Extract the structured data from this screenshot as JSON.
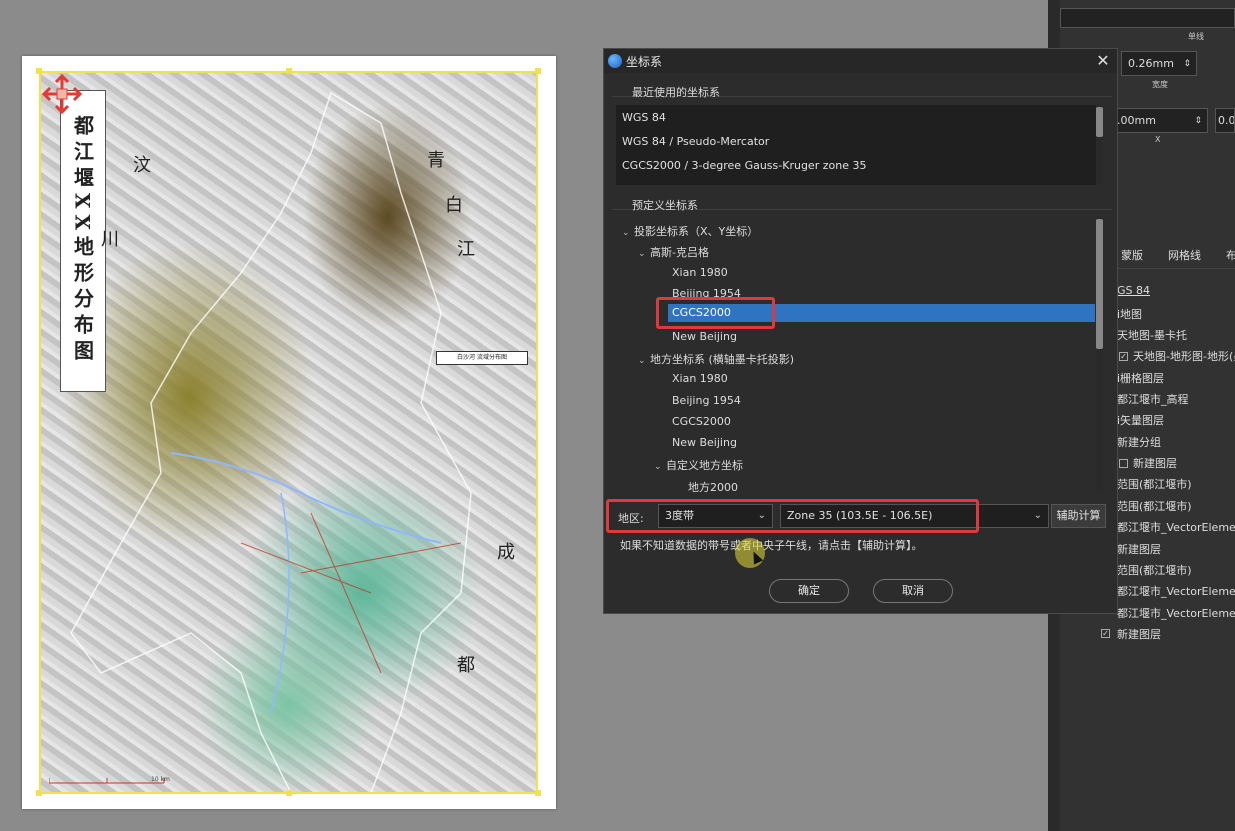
{
  "map": {
    "title": "都江堰XX地形分布图",
    "callout": "白沙河 流域分布图",
    "places": [
      "汶",
      "川",
      "青",
      "白",
      "江",
      "成",
      "都"
    ],
    "scale_text": "10 km"
  },
  "right_panel": {
    "line_label": "单线",
    "width_value": "0.26mm",
    "width_label": "宽度",
    "x_value": ".00mm",
    "x_label": "X",
    "y_value": "0.0",
    "tabs": [
      "蒙版",
      "网格线",
      "布"
    ],
    "layers": [
      "GS 84",
      "i地图",
      "天地图-墨卡托",
      "天地图-地形图-地形(墨",
      "i栅格图层",
      "都江堰市_高程",
      "i矢量图层",
      "新建分组",
      "新建图层",
      "范围(都江堰市)",
      "范围(都江堰市)",
      "都江堰市_VectorElement",
      "新建图层",
      "范围(都江堰市)",
      "都江堰市_VectorElement",
      "都江堰市_VectorElement",
      "新建图层"
    ]
  },
  "dialog": {
    "title": "坐标系",
    "recent_group": "最近使用的坐标系",
    "recent": [
      "WGS 84",
      "WGS 84 / Pseudo-Mercator",
      "CGCS2000 / 3-degree Gauss-Kruger zone 35"
    ],
    "predef_group": "预定义坐标系",
    "tree": {
      "projected": "投影坐标系（X、Y坐标）",
      "gauss": "高斯-克吕格",
      "gauss_items": [
        "Xian 1980",
        "Beijing 1954",
        "CGCS2000",
        "New Beijing"
      ],
      "local": "地方坐标系 (横轴墨卡托投影)",
      "local_items": [
        "Xian 1980",
        "Beijing 1954",
        "CGCS2000",
        "New Beijing"
      ],
      "custom": "自定义地方坐标",
      "custom_items": [
        "地方2000"
      ]
    },
    "region_label": "地区:",
    "band_value": "3度带",
    "zone_value": "Zone 35 (103.5E - 106.5E)",
    "calc_button": "辅助计算",
    "hint": "如果不知道数据的带号或者中央子午线，请点击【辅助计算】。",
    "ok": "确定",
    "cancel": "取消"
  }
}
